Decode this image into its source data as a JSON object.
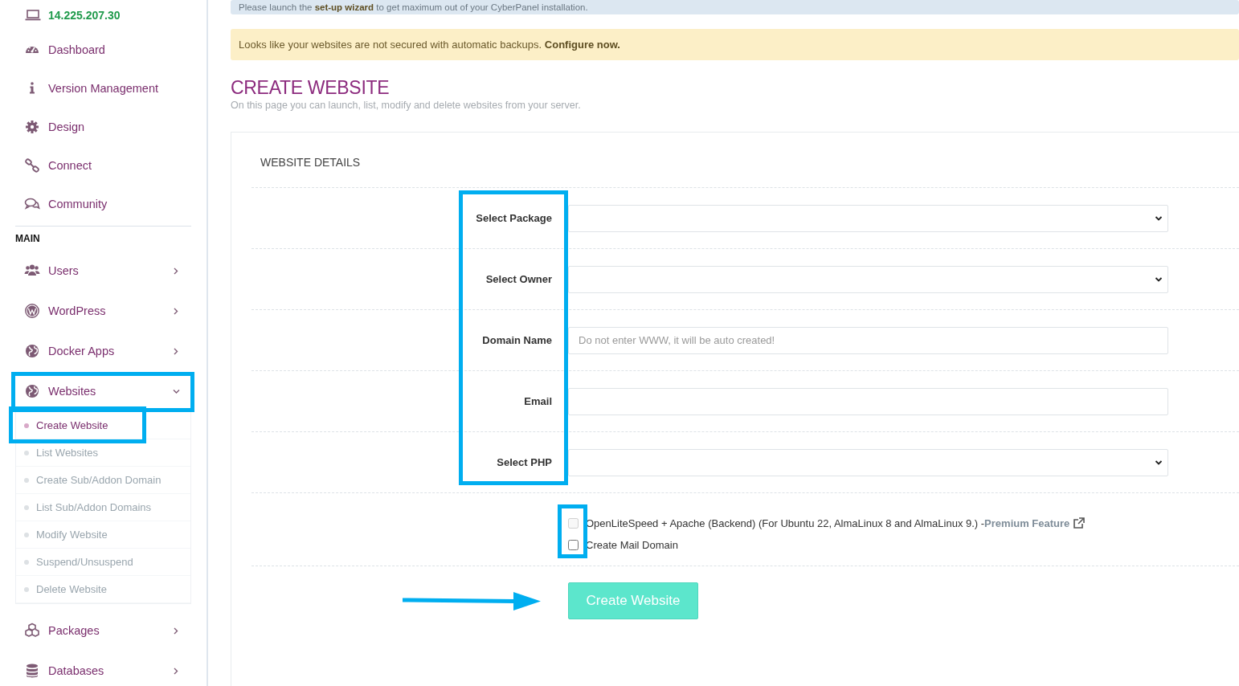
{
  "sidebar": {
    "server_ip": "14.225.207.30",
    "top_items": [
      {
        "label": "Dashboard"
      },
      {
        "label": "Version Management"
      },
      {
        "label": "Design"
      },
      {
        "label": "Connect"
      },
      {
        "label": "Community"
      }
    ],
    "section_label": "MAIN",
    "main_items": [
      {
        "label": "Users",
        "has_submenu": true,
        "expanded": false,
        "highlighted": false
      },
      {
        "label": "WordPress",
        "has_submenu": true,
        "expanded": false,
        "highlighted": false
      },
      {
        "label": "Docker Apps",
        "has_submenu": true,
        "expanded": false,
        "highlighted": false
      },
      {
        "label": "Websites",
        "has_submenu": true,
        "expanded": true,
        "highlighted": true,
        "children": [
          {
            "label": "Create Website",
            "selected": true,
            "highlighted": true
          },
          {
            "label": "List Websites",
            "selected": false,
            "highlighted": false
          },
          {
            "label": "Create Sub/Addon Domain",
            "selected": false,
            "highlighted": false
          },
          {
            "label": "List Sub/Addon Domains",
            "selected": false,
            "highlighted": false
          },
          {
            "label": "Modify Website",
            "selected": false,
            "highlighted": false
          },
          {
            "label": "Suspend/Unsuspend",
            "selected": false,
            "highlighted": false
          },
          {
            "label": "Delete Website",
            "selected": false,
            "highlighted": false
          }
        ]
      },
      {
        "label": "Packages",
        "has_submenu": true,
        "expanded": false,
        "highlighted": false
      },
      {
        "label": "Databases",
        "has_submenu": true,
        "expanded": false,
        "highlighted": false
      }
    ]
  },
  "alerts": [
    {
      "kind": "info",
      "text": "Please launch the **set-up wizard** to get maximum out of your CyberPanel installation."
    },
    {
      "kind": "warning",
      "text": "Looks like your websites are not secured with automatic backups. **Configure now.**"
    }
  ],
  "page": {
    "title": "CREATE WEBSITE",
    "subtitle": "On this page you can launch, list, modify and delete websites from your server."
  },
  "panel": {
    "heading": "WEBSITE DETAILS",
    "labels_highlighted": true,
    "fields": [
      {
        "label": "Select Package",
        "kind": "select"
      },
      {
        "label": "Select Owner",
        "kind": "select"
      },
      {
        "label": "Domain Name",
        "kind": "text",
        "placeholder": "Do not enter WWW, it will be auto created!"
      },
      {
        "label": "Email",
        "kind": "text"
      },
      {
        "label": "Select PHP",
        "kind": "select"
      }
    ],
    "options_highlighted": true,
    "options": [
      {
        "label": "OpenLiteSpeed + Apache (Backend) (For Ubuntu 22, AlmaLinux 8 and AlmaLinux 9.) - ",
        "link": "Premium Feature",
        "checked": false,
        "disabled": true
      },
      {
        "label": "Create Mail Domain",
        "checked": false,
        "disabled": false
      }
    ],
    "submit": {
      "label": "Create Website",
      "arrow_pointer": true
    }
  }
}
